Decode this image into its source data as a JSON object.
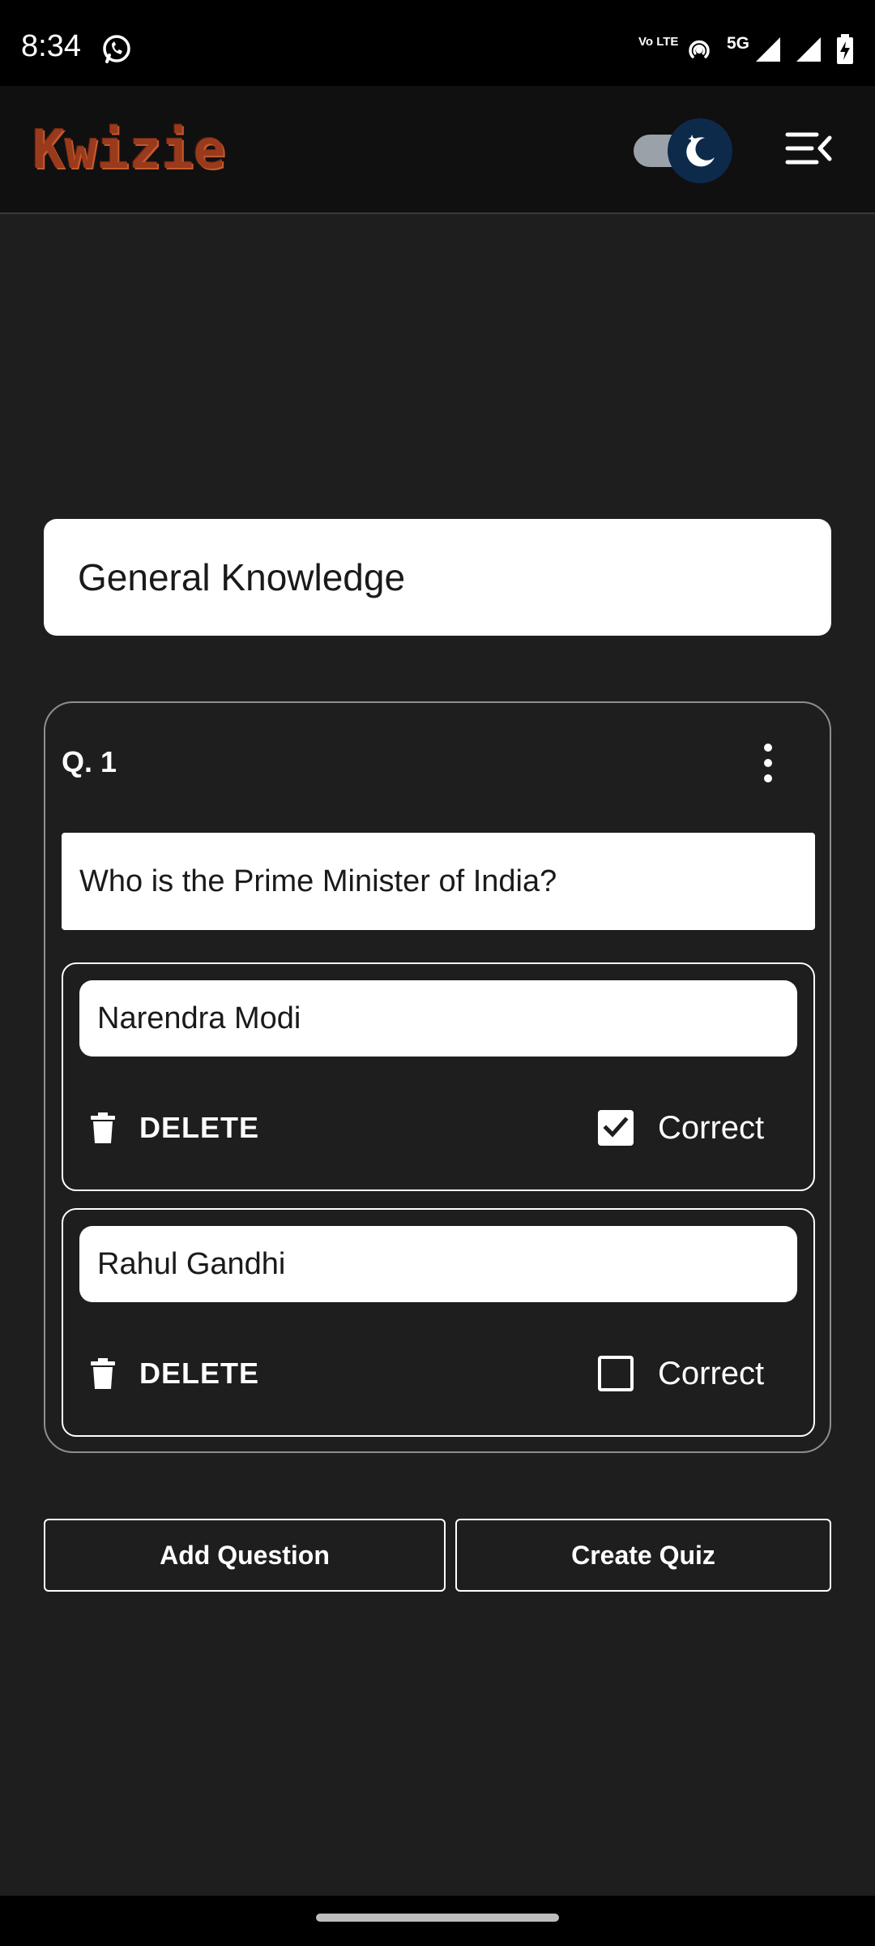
{
  "status_bar": {
    "time": "8:34",
    "volte": "Vo LTE",
    "network": "5G",
    "icons": [
      "whatsapp-icon",
      "hotspot-icon",
      "signal-icon",
      "signal-icon",
      "battery-charging-icon"
    ]
  },
  "app_bar": {
    "logo": "Kwizie",
    "theme_toggle": "dark-mode",
    "menu_icon": "menu-collapse-icon"
  },
  "quiz": {
    "title": "General Knowledge",
    "questions": [
      {
        "number": "Q. 1",
        "text": "Who is the Prime Minister of India?",
        "options": [
          {
            "text": "Narendra Modi",
            "delete_label": "DELETE",
            "correct_label": "Correct",
            "is_correct": true
          },
          {
            "text": "Rahul Gandhi",
            "delete_label": "DELETE",
            "correct_label": "Correct",
            "is_correct": false
          }
        ]
      }
    ]
  },
  "actions": {
    "add_question": "Add Question",
    "create_quiz": "Create Quiz"
  },
  "colors": {
    "background": "#1e1e1f",
    "appbar": "#101011",
    "logo": "#9a3a1c",
    "toggle_knob": "#0d2a4a"
  }
}
